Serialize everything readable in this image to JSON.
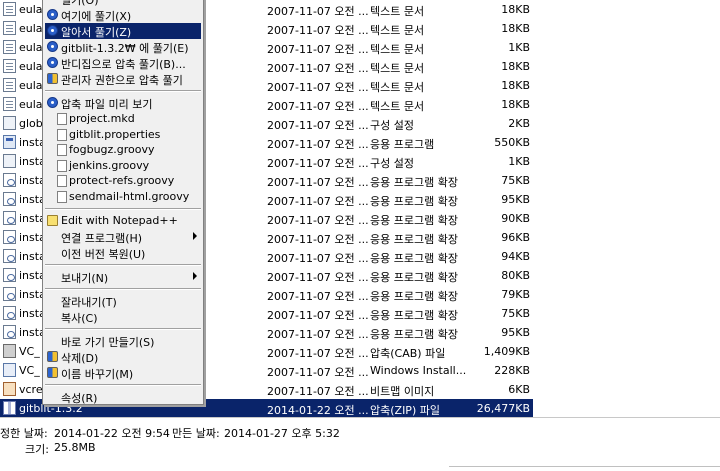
{
  "files": [
    {
      "name": "eula",
      "date": "2007-11-07 오전 ...",
      "type": "텍스트 문서",
      "size": "18KB",
      "icon": "document-icon"
    },
    {
      "name": "eula",
      "date": "2007-11-07 오전 ...",
      "type": "텍스트 문서",
      "size": "18KB",
      "icon": "document-icon"
    },
    {
      "name": "eula",
      "date": "2007-11-07 오전 ...",
      "type": "텍스트 문서",
      "size": "1KB",
      "icon": "document-icon"
    },
    {
      "name": "eula",
      "date": "2007-11-07 오전 ...",
      "type": "텍스트 문서",
      "size": "18KB",
      "icon": "document-icon"
    },
    {
      "name": "eula",
      "date": "2007-11-07 오전 ...",
      "type": "텍스트 문서",
      "size": "18KB",
      "icon": "document-icon"
    },
    {
      "name": "eula",
      "date": "2007-11-07 오전 ...",
      "type": "텍스트 문서",
      "size": "18KB",
      "icon": "document-icon"
    },
    {
      "name": "glob",
      "date": "2007-11-07 오전 ...",
      "type": "구성 설정",
      "size": "2KB",
      "icon": "config-icon"
    },
    {
      "name": "insta",
      "date": "2007-11-07 오전 ...",
      "type": "응용 프로그램",
      "size": "550KB",
      "icon": "application-icon"
    },
    {
      "name": "insta",
      "date": "2007-11-07 오전 ...",
      "type": "구성 설정",
      "size": "1KB",
      "icon": "config-icon"
    },
    {
      "name": "insta",
      "date": "2007-11-07 오전 ...",
      "type": "응용 프로그램 확장",
      "size": "75KB",
      "icon": "dll-icon"
    },
    {
      "name": "insta",
      "date": "2007-11-07 오전 ...",
      "type": "응용 프로그램 확장",
      "size": "95KB",
      "icon": "dll-icon"
    },
    {
      "name": "insta",
      "date": "2007-11-07 오전 ...",
      "type": "응용 프로그램 확장",
      "size": "90KB",
      "icon": "dll-icon"
    },
    {
      "name": "insta",
      "date": "2007-11-07 오전 ...",
      "type": "응용 프로그램 확장",
      "size": "96KB",
      "icon": "dll-icon"
    },
    {
      "name": "insta",
      "date": "2007-11-07 오전 ...",
      "type": "응용 프로그램 확장",
      "size": "94KB",
      "icon": "dll-icon"
    },
    {
      "name": "insta",
      "date": "2007-11-07 오전 ...",
      "type": "응용 프로그램 확장",
      "size": "80KB",
      "icon": "dll-icon"
    },
    {
      "name": "insta",
      "date": "2007-11-07 오전 ...",
      "type": "응용 프로그램 확장",
      "size": "79KB",
      "icon": "dll-icon"
    },
    {
      "name": "insta",
      "date": "2007-11-07 오전 ...",
      "type": "응용 프로그램 확장",
      "size": "75KB",
      "icon": "dll-icon"
    },
    {
      "name": "insta",
      "date": "2007-11-07 오전 ...",
      "type": "응용 프로그램 확장",
      "size": "95KB",
      "icon": "dll-icon"
    },
    {
      "name": "VC_",
      "date": "2007-11-07 오전 ...",
      "type": "압축(CAB) 파일",
      "size": "1,409KB",
      "icon": "cab-icon"
    },
    {
      "name": "VC_",
      "date": "2007-11-07 오전 ...",
      "type": "Windows Install...",
      "size": "228KB",
      "icon": "installer-icon"
    },
    {
      "name": "vcre",
      "date": "2007-11-07 오전 ...",
      "type": "비트맵 이미지",
      "size": "6KB",
      "icon": "bitmap-icon"
    },
    {
      "name": "gitblit-1.3.2",
      "date": "2014-01-22 오전 ...",
      "type": "압축(ZIP) 파일",
      "size": "26,477KB",
      "icon": "zip-icon",
      "selected": true
    }
  ],
  "context_menu": {
    "items": [
      {
        "label": "열기(O)",
        "icon": "none"
      },
      {
        "label": "여기에 풀기(X)",
        "icon": "alzip-icon"
      },
      {
        "label": "알아서 풀기(Z)",
        "icon": "alzip-icon",
        "highlighted": true
      },
      {
        "label": "gitblit-1.3.2₩ 에 풀기(E)",
        "icon": "alzip-icon"
      },
      {
        "label": "반디집으로 압축 풀기(B)...",
        "icon": "alzip-icon"
      },
      {
        "label": "관리자 권한으로 압축 풀기",
        "icon": "shield-icon"
      },
      {
        "sep": true
      },
      {
        "label": "압축 파일 미리 보기",
        "icon": "alzip-icon"
      },
      {
        "label": "project.mkd",
        "sub": true
      },
      {
        "label": "gitblit.properties",
        "sub": true
      },
      {
        "label": "fogbugz.groovy",
        "sub": true
      },
      {
        "label": "jenkins.groovy",
        "sub": true
      },
      {
        "label": "protect-refs.groovy",
        "sub": true
      },
      {
        "label": "sendmail-html.groovy",
        "sub": true
      },
      {
        "sep": true
      },
      {
        "label": "Edit with Notepad++",
        "icon": "notepad-icon"
      },
      {
        "label": "연결 프로그램(H)",
        "arrow": true
      },
      {
        "label": "이전 버전 복원(U)"
      },
      {
        "sep": true
      },
      {
        "label": "보내기(N)",
        "arrow": true
      },
      {
        "sep": true
      },
      {
        "label": "잘라내기(T)"
      },
      {
        "label": "복사(C)"
      },
      {
        "sep": true
      },
      {
        "label": "바로 가기 만들기(S)"
      },
      {
        "label": "삭제(D)",
        "icon": "shield-icon"
      },
      {
        "label": "이름 바꾸기(M)",
        "icon": "shield-icon"
      },
      {
        "sep": true
      },
      {
        "label": "속성(R)"
      }
    ]
  },
  "status": {
    "modified_label": "정한 날짜:",
    "modified_value": "2014-01-22 오전 9:54",
    "created_label": "만든 날짜:",
    "created_value": "2014-01-27 오후 5:32",
    "size_label": "크기:",
    "size_value": "25.8MB"
  },
  "colors": {
    "selection": "#0a246a",
    "menu_bg": "#f0f0f0"
  }
}
